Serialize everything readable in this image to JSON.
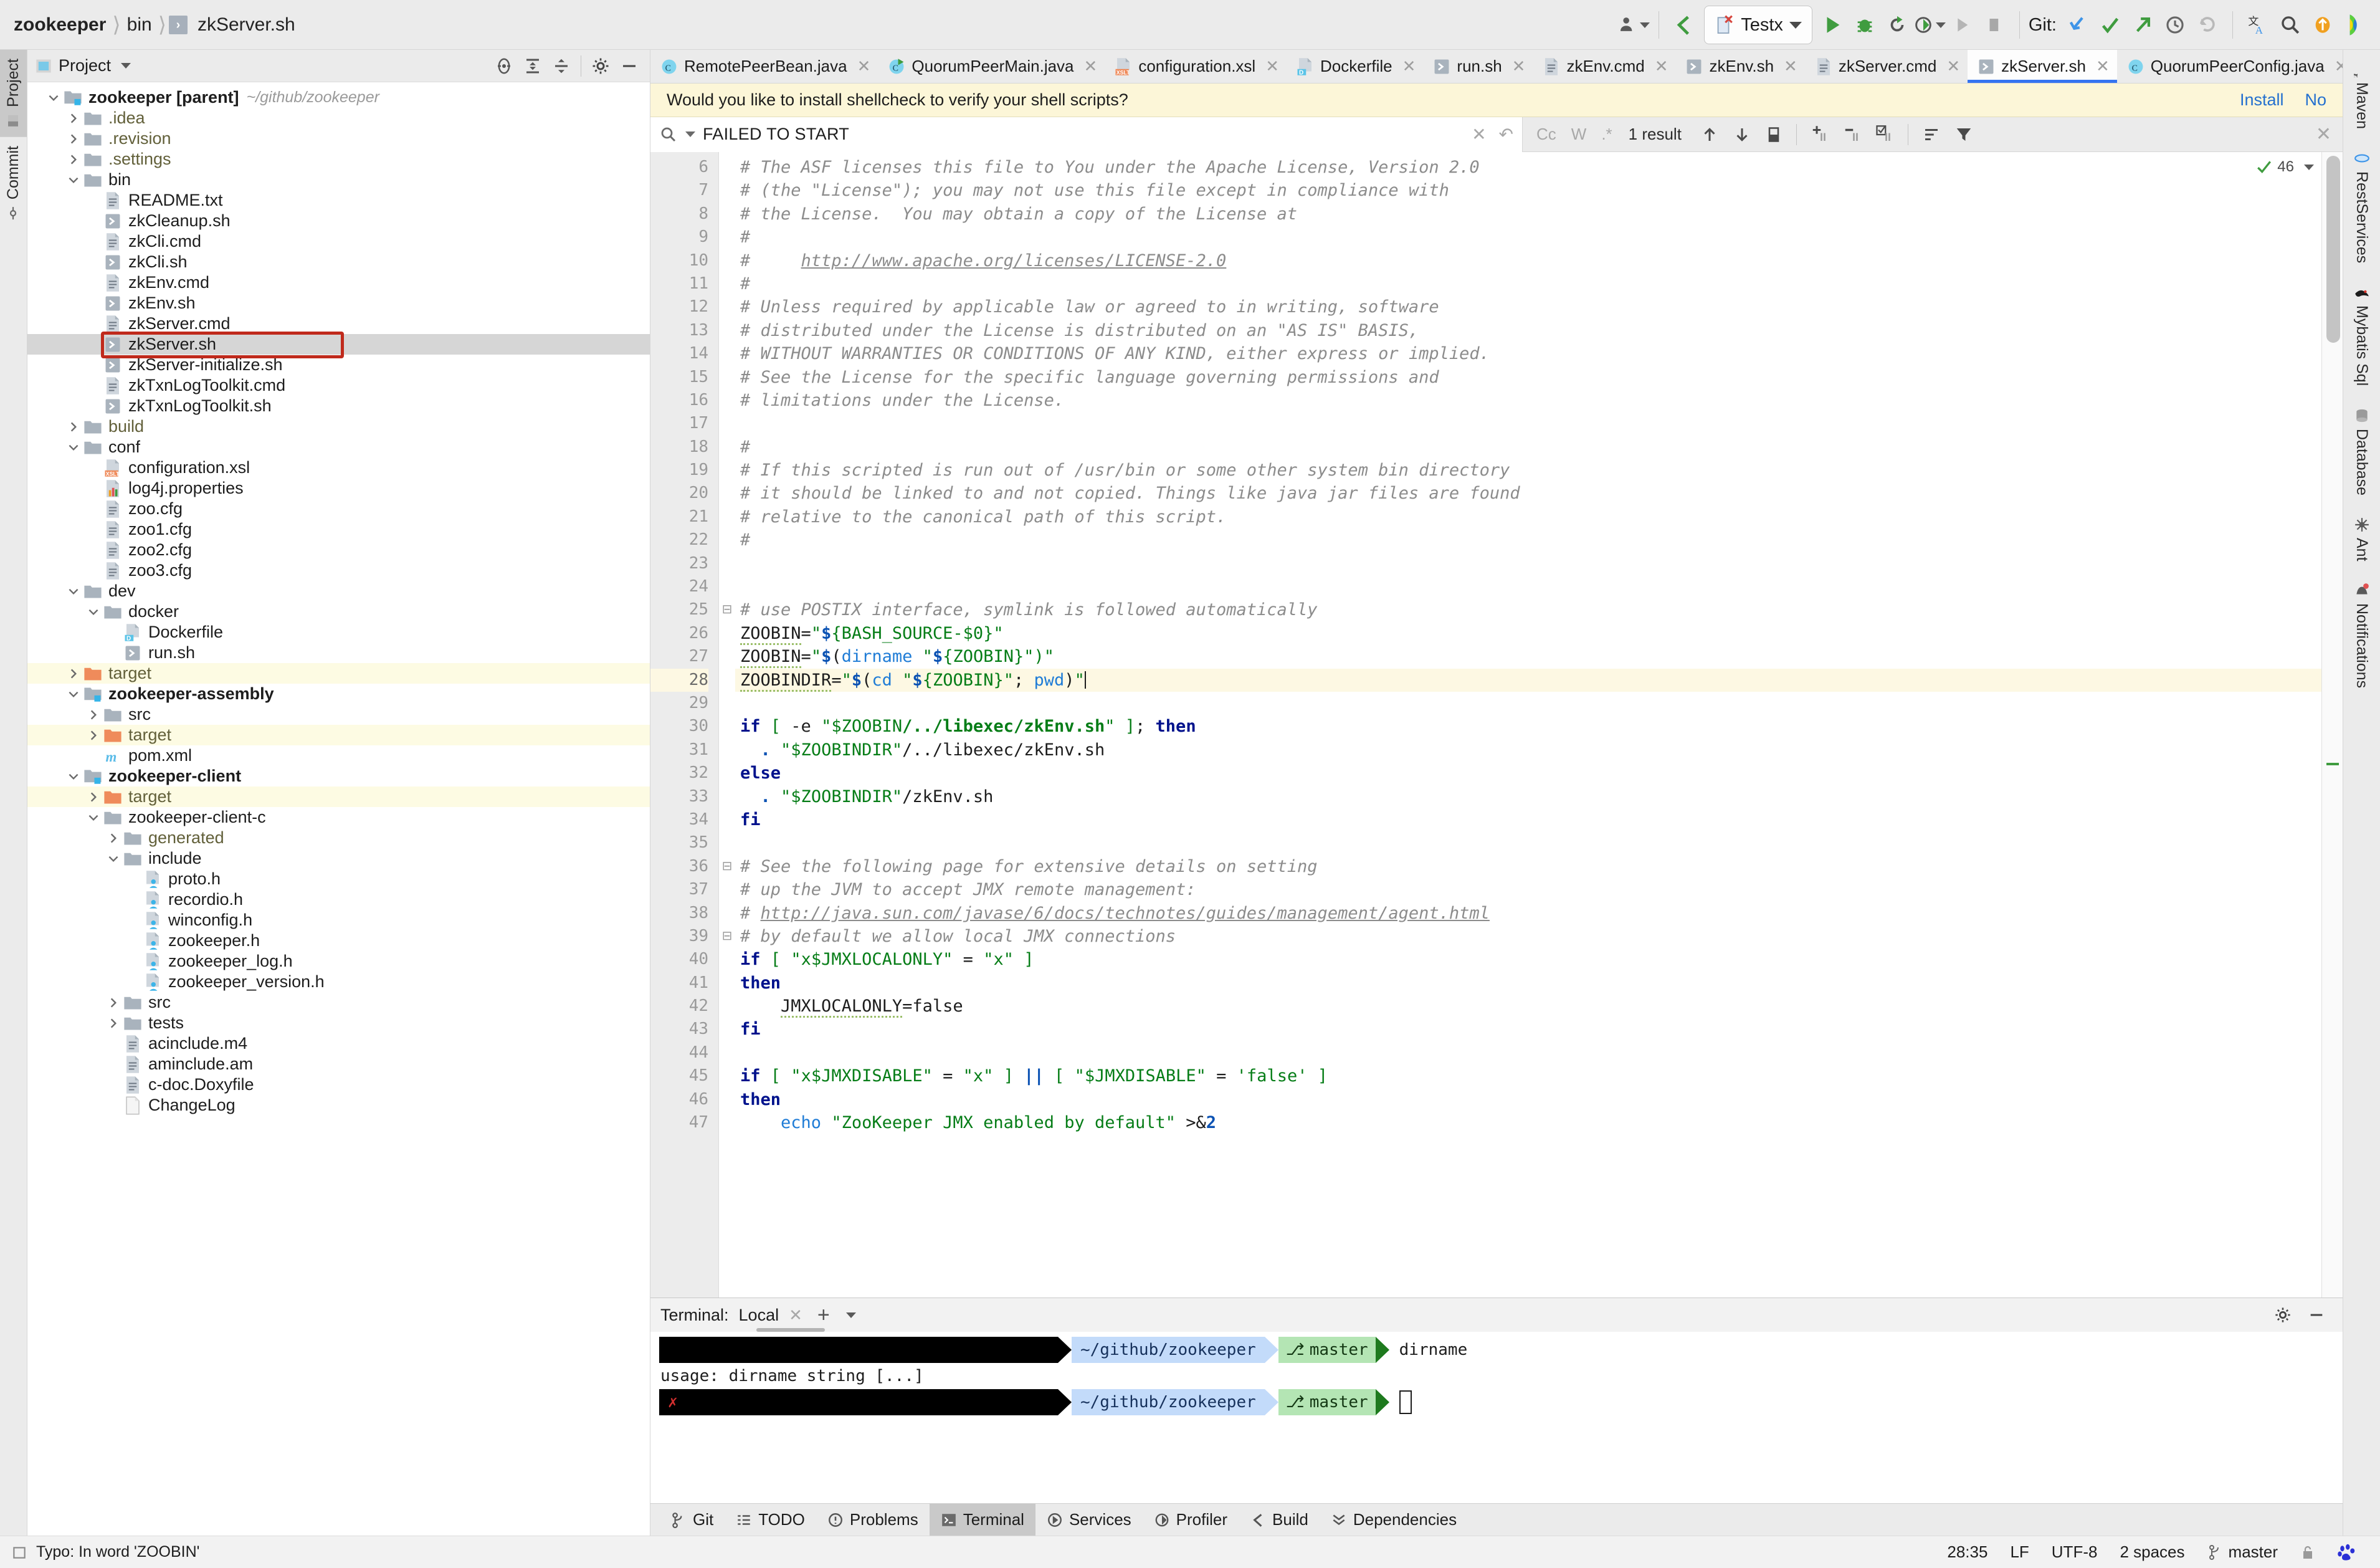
{
  "breadcrumb": {
    "items": [
      "zookeeper",
      "bin",
      "zkServer.sh"
    ],
    "sh_badge": "›"
  },
  "toolbar": {
    "run_config_label": "Testx",
    "git_label": "Git:",
    "icons": [
      "user-avatar-icon",
      "back-arrow-icon",
      "run-icon",
      "debug-icon",
      "rerun-icon",
      "coverage-icon",
      "profile-icon",
      "stop-icon",
      "git-update-icon",
      "git-commit-icon",
      "git-push-icon",
      "history-icon",
      "rollback-icon",
      "translate-icon",
      "search-everywhere-icon",
      "updates-icon",
      "ide-icon"
    ]
  },
  "left_strip": {
    "tabs": [
      {
        "label": "Project",
        "active": true
      },
      {
        "label": "Commit",
        "active": false
      }
    ]
  },
  "right_strip": {
    "tabs": [
      {
        "label": "Maven",
        "icon": "maven-icon"
      },
      {
        "label": "RestServices",
        "icon": "rest-services-icon"
      },
      {
        "label": "Mybatis Sql",
        "icon": "mybatis-icon"
      },
      {
        "label": "Database",
        "icon": "database-icon"
      },
      {
        "label": "Ant",
        "icon": "ant-icon"
      },
      {
        "label": "Notifications",
        "icon": "notifications-icon"
      }
    ]
  },
  "project": {
    "title": "Project",
    "tools": [
      "locate-icon",
      "expand-all-icon",
      "collapse-all-icon",
      "settings-gear-icon",
      "hide-icon"
    ],
    "tree": [
      {
        "depth": 0,
        "arrow": "down",
        "icon": "module-folder",
        "label": "zookeeper [parent]",
        "bold": true,
        "path": "~/github/zookeeper"
      },
      {
        "depth": 1,
        "arrow": "right",
        "icon": "folder",
        "label": ".idea",
        "olive": true
      },
      {
        "depth": 1,
        "arrow": "right",
        "icon": "folder",
        "label": ".revision",
        "olive": true
      },
      {
        "depth": 1,
        "arrow": "right",
        "icon": "folder",
        "label": ".settings",
        "olive": true
      },
      {
        "depth": 1,
        "arrow": "down",
        "icon": "folder",
        "label": "bin"
      },
      {
        "depth": 2,
        "arrow": "none",
        "icon": "text-file",
        "label": "README.txt"
      },
      {
        "depth": 2,
        "arrow": "none",
        "icon": "shell-file",
        "label": "zkCleanup.sh"
      },
      {
        "depth": 2,
        "arrow": "none",
        "icon": "text-file",
        "label": "zkCli.cmd"
      },
      {
        "depth": 2,
        "arrow": "none",
        "icon": "shell-file",
        "label": "zkCli.sh"
      },
      {
        "depth": 2,
        "arrow": "none",
        "icon": "text-file",
        "label": "zkEnv.cmd"
      },
      {
        "depth": 2,
        "arrow": "none",
        "icon": "shell-file",
        "label": "zkEnv.sh"
      },
      {
        "depth": 2,
        "arrow": "none",
        "icon": "text-file",
        "label": "zkServer.cmd"
      },
      {
        "depth": 2,
        "arrow": "none",
        "icon": "shell-file",
        "label": "zkServer.sh",
        "selected": true,
        "highlight": true
      },
      {
        "depth": 2,
        "arrow": "none",
        "icon": "shell-file",
        "label": "zkServer-initialize.sh"
      },
      {
        "depth": 2,
        "arrow": "none",
        "icon": "text-file",
        "label": "zkTxnLogToolkit.cmd"
      },
      {
        "depth": 2,
        "arrow": "none",
        "icon": "shell-file",
        "label": "zkTxnLogToolkit.sh"
      },
      {
        "depth": 1,
        "arrow": "right",
        "icon": "folder",
        "label": "build",
        "olive": true
      },
      {
        "depth": 1,
        "arrow": "down",
        "icon": "folder",
        "label": "conf"
      },
      {
        "depth": 2,
        "arrow": "none",
        "icon": "xslt-file",
        "label": "configuration.xsl"
      },
      {
        "depth": 2,
        "arrow": "none",
        "icon": "properties-file",
        "label": "log4j.properties"
      },
      {
        "depth": 2,
        "arrow": "none",
        "icon": "text-file",
        "label": "zoo.cfg"
      },
      {
        "depth": 2,
        "arrow": "none",
        "icon": "text-file",
        "label": "zoo1.cfg"
      },
      {
        "depth": 2,
        "arrow": "none",
        "icon": "text-file",
        "label": "zoo2.cfg"
      },
      {
        "depth": 2,
        "arrow": "none",
        "icon": "text-file",
        "label": "zoo3.cfg"
      },
      {
        "depth": 1,
        "arrow": "down",
        "icon": "folder",
        "label": "dev"
      },
      {
        "depth": 2,
        "arrow": "down",
        "icon": "folder",
        "label": "docker"
      },
      {
        "depth": 3,
        "arrow": "none",
        "icon": "docker-file",
        "label": "Dockerfile"
      },
      {
        "depth": 3,
        "arrow": "none",
        "icon": "shell-file",
        "label": "run.sh"
      },
      {
        "depth": 1,
        "arrow": "right",
        "icon": "target-folder",
        "label": "target",
        "olive": true,
        "target": true
      },
      {
        "depth": 1,
        "arrow": "down",
        "icon": "module-folder",
        "label": "zookeeper-assembly",
        "bold": true
      },
      {
        "depth": 2,
        "arrow": "right",
        "icon": "folder",
        "label": "src"
      },
      {
        "depth": 2,
        "arrow": "right",
        "icon": "target-folder",
        "label": "target",
        "olive": true,
        "target": true
      },
      {
        "depth": 2,
        "arrow": "none",
        "icon": "maven-file",
        "label": "pom.xml"
      },
      {
        "depth": 1,
        "arrow": "down",
        "icon": "module-folder",
        "label": "zookeeper-client",
        "bold": true
      },
      {
        "depth": 2,
        "arrow": "right",
        "icon": "target-folder",
        "label": "target",
        "olive": true,
        "target": true
      },
      {
        "depth": 2,
        "arrow": "down",
        "icon": "folder",
        "label": "zookeeper-client-c"
      },
      {
        "depth": 3,
        "arrow": "right",
        "icon": "folder",
        "label": "generated",
        "olive": true
      },
      {
        "depth": 3,
        "arrow": "down",
        "icon": "folder",
        "label": "include"
      },
      {
        "depth": 4,
        "arrow": "none",
        "icon": "header-file",
        "label": "proto.h"
      },
      {
        "depth": 4,
        "arrow": "none",
        "icon": "header-file",
        "label": "recordio.h"
      },
      {
        "depth": 4,
        "arrow": "none",
        "icon": "header-file",
        "label": "winconfig.h"
      },
      {
        "depth": 4,
        "arrow": "none",
        "icon": "header-file",
        "label": "zookeeper.h"
      },
      {
        "depth": 4,
        "arrow": "none",
        "icon": "header-file",
        "label": "zookeeper_log.h"
      },
      {
        "depth": 4,
        "arrow": "none",
        "icon": "header-file",
        "label": "zookeeper_version.h"
      },
      {
        "depth": 3,
        "arrow": "right",
        "icon": "folder",
        "label": "src"
      },
      {
        "depth": 3,
        "arrow": "right",
        "icon": "folder",
        "label": "tests"
      },
      {
        "depth": 3,
        "arrow": "none",
        "icon": "text-file",
        "label": "acinclude.m4"
      },
      {
        "depth": 3,
        "arrow": "none",
        "icon": "text-file",
        "label": "aminclude.am"
      },
      {
        "depth": 3,
        "arrow": "none",
        "icon": "text-file",
        "label": "c-doc.Doxyfile"
      },
      {
        "depth": 3,
        "arrow": "none",
        "icon": "plain-file",
        "label": "ChangeLog"
      }
    ]
  },
  "editor_tabs": [
    {
      "label": "RemotePeerBean.java",
      "icon": "java-class-icon",
      "active": false
    },
    {
      "label": "QuorumPeerMain.java",
      "icon": "java-run-icon",
      "active": false
    },
    {
      "label": "configuration.xsl",
      "icon": "xslt-file",
      "active": false
    },
    {
      "label": "Dockerfile",
      "icon": "docker-file",
      "active": false
    },
    {
      "label": "run.sh",
      "icon": "shell-file",
      "active": false
    },
    {
      "label": "zkEnv.cmd",
      "icon": "text-file",
      "active": false
    },
    {
      "label": "zkEnv.sh",
      "icon": "shell-file",
      "active": false
    },
    {
      "label": "zkServer.cmd",
      "icon": "text-file",
      "active": false
    },
    {
      "label": "zkServer.sh",
      "icon": "shell-file",
      "active": true
    },
    {
      "label": "QuorumPeerConfig.java",
      "icon": "java-class-icon",
      "active": false
    }
  ],
  "notification": {
    "message": "Would you like to install shellcheck to verify your shell scripts?",
    "install_label": "Install",
    "no_label": "No"
  },
  "find": {
    "query": "FAILED TO START",
    "result_count": "1 result",
    "opt_case": "Cc",
    "opt_word": "W",
    "opt_regex": ".*",
    "icons": [
      "search-dropdown-icon",
      "clear-icon",
      "history-icon",
      "prev-match-icon",
      "next-match-icon",
      "select-all-icon",
      "add-line-icon",
      "remove-line-icon",
      "check-line-icon",
      "sort-icon",
      "filter-icon",
      "close-find-icon"
    ]
  },
  "inspection": {
    "count": "46",
    "status_icon": "checkmark-green-icon"
  },
  "code": {
    "first_line": 6,
    "current_line": 28,
    "lines": [
      {
        "n": 6,
        "html": "<span class='cm'># The ASF licenses this file to You under the Apache License, Version 2.0</span>"
      },
      {
        "n": 7,
        "html": "<span class='cm'># (the \"License\"); you may not use this file except in compliance with</span>"
      },
      {
        "n": 8,
        "html": "<span class='cm'># the License.  You may obtain a copy of the License at</span>"
      },
      {
        "n": 9,
        "html": "<span class='cm'>#</span>"
      },
      {
        "n": 10,
        "html": "<span class='cm'>#     </span><span class='lnk'>http://www.apache.org/licenses/LICENSE-2.0</span>"
      },
      {
        "n": 11,
        "html": "<span class='cm'>#</span>"
      },
      {
        "n": 12,
        "html": "<span class='cm'># Unless required by applicable law or agreed to in writing, software</span>"
      },
      {
        "n": 13,
        "html": "<span class='cm'># distributed under the License is distributed on an \"AS IS\" BASIS,</span>"
      },
      {
        "n": 14,
        "html": "<span class='cm'># WITHOUT WARRANTIES OR CONDITIONS OF ANY KIND, either express or implied.</span>"
      },
      {
        "n": 15,
        "html": "<span class='cm'># See the License for the specific language governing permissions and</span>"
      },
      {
        "n": 16,
        "html": "<span class='cm'># limitations under the License.</span>"
      },
      {
        "n": 17,
        "html": ""
      },
      {
        "n": 18,
        "html": "<span class='cm'>#</span>"
      },
      {
        "n": 19,
        "html": "<span class='cm'># If this scripted is run out of /usr/bin or some other system bin directory</span>"
      },
      {
        "n": 20,
        "html": "<span class='cm'># it should be linked to and not copied. Things like java jar files are found</span>"
      },
      {
        "n": 21,
        "html": "<span class='cm'># relative to the canonical path of this script.</span>"
      },
      {
        "n": 22,
        "html": "<span class='cm'>#</span>"
      },
      {
        "n": 23,
        "html": ""
      },
      {
        "n": 24,
        "html": ""
      },
      {
        "n": 25,
        "html": "<span class='cm'># use POSTIX interface, symlink is followed automatically</span>",
        "fold": "minus"
      },
      {
        "n": 26,
        "html": "<span class='sq'>ZOOBIN</span>=<span class='str'>\"</span><span class='var'>$</span><span class='str'>{BASH_SOURCE-$0}\"</span>"
      },
      {
        "n": 27,
        "html": "<span class='sq'>ZOOBIN</span>=<span class='str'>\"</span><span class='var'>$</span>(<span class='fn'>dirname</span> <span class='str'>\"</span><span class='var'>$</span><span class='str'>{ZOOBIN}\")\"</span>"
      },
      {
        "n": 28,
        "html": "<span class='sq'>ZOOBINDIR</span>=<span class='str'>\"</span><span class='var'>$</span>(<span class='fn'>cd</span> <span class='str'>\"</span><span class='var'>$</span><span class='str'>{ZOOBIN}\"</span>; <span class='fn'>pwd</span>)<span class='str'>\"</span><span class='caret'></span>",
        "current": true
      },
      {
        "n": 29,
        "html": ""
      },
      {
        "n": 30,
        "html": "<span class='kw'>if</span> <span class='pl'>[</span> -e <span class='str'>\"$ZOOBIN</span><span class='str' style='font-weight:bold'>/../libexec/zkEnv.sh</span><span class='str'>\"</span> <span class='pl'>]</span>; <span class='kw'>then</span>"
      },
      {
        "n": 31,
        "html": "  <span class='var'>.</span> <span class='str'>\"$ZOOBINDIR\"</span>/../libexec/zkEnv.sh"
      },
      {
        "n": 32,
        "html": "<span class='kw'>else</span>"
      },
      {
        "n": 33,
        "html": "  <span class='var'>.</span> <span class='str'>\"$ZOOBINDIR\"</span>/zkEnv.sh"
      },
      {
        "n": 34,
        "html": "<span class='kw'>fi</span>"
      },
      {
        "n": 35,
        "html": ""
      },
      {
        "n": 36,
        "html": "<span class='cm'># See the following page for extensive details on setting</span>",
        "fold": "minus"
      },
      {
        "n": 37,
        "html": "<span class='cm'># up the JVM to accept JMX remote management:</span>"
      },
      {
        "n": 38,
        "html": "<span class='cm'># </span><span class='lnk'>http://java.sun.com/javase/6/docs/technotes/guides/management/agent.html</span>"
      },
      {
        "n": 39,
        "html": "<span class='cm'># by default we allow local JMX connections</span>",
        "fold": "minus"
      },
      {
        "n": 40,
        "html": "<span class='kw'>if</span> <span class='pl'>[</span> <span class='str'>\"x$JMXLOCALONLY\"</span> = <span class='str'>\"x\"</span> <span class='pl'>]</span>"
      },
      {
        "n": 41,
        "html": "<span class='kw'>then</span>"
      },
      {
        "n": 42,
        "html": "    <span class='sq'>JMXLOCALONLY</span>=false"
      },
      {
        "n": 43,
        "html": "<span class='kw'>fi</span>"
      },
      {
        "n": 44,
        "html": ""
      },
      {
        "n": 45,
        "html": "<span class='kw'>if</span> <span class='pl'>[</span> <span class='str'>\"x$JMXDISABLE\"</span> = <span class='str'>\"x\"</span> <span class='pl'>]</span> <span class='var'>||</span> <span class='pl'>[</span> <span class='str'>\"$JMXDISABLE\"</span> = <span class='str'>'false'</span> <span class='pl'>]</span>"
      },
      {
        "n": 46,
        "html": "<span class='kw'>then</span>"
      },
      {
        "n": 47,
        "html": "    <span class='fn'>echo</span> <span class='str'>\"ZooKeeper JMX enabled by default\"</span> &gt;&amp;<span class='var'>2</span>"
      }
    ]
  },
  "terminal": {
    "title": "Terminal:",
    "tab_label": "Local",
    "lines": [
      {
        "type": "prompt",
        "path": "~/github/zookeeper",
        "branch": "master",
        "command": "dirname",
        "error": false
      },
      {
        "type": "output",
        "text": "usage: dirname string [...]"
      },
      {
        "type": "prompt",
        "path": "~/github/zookeeper",
        "branch": "master",
        "command": "",
        "error": true
      }
    ]
  },
  "bottom_tabs": [
    {
      "label": "Git",
      "icon": "git-branch-icon",
      "active": false
    },
    {
      "label": "TODO",
      "icon": "todo-icon",
      "active": false
    },
    {
      "label": "Problems",
      "icon": "problems-icon",
      "active": false
    },
    {
      "label": "Terminal",
      "icon": "terminal-icon",
      "active": true
    },
    {
      "label": "Services",
      "icon": "services-icon",
      "active": false
    },
    {
      "label": "Profiler",
      "icon": "profiler-icon",
      "active": false
    },
    {
      "label": "Build",
      "icon": "build-icon",
      "active": false
    },
    {
      "label": "Dependencies",
      "icon": "dependencies-icon",
      "active": false
    }
  ],
  "status": {
    "message": "Typo: In word 'ZOOBIN'",
    "caret_position": "28:35",
    "line_separator": "LF",
    "encoding": "UTF-8",
    "indent": "2 spaces",
    "branch": "master"
  },
  "colors": {
    "accent": "#3574f0",
    "notification_bg": "#fcf6d8",
    "highlight_box": "#c02a1c",
    "target_folder": "#ef8b5b",
    "keyword": "#00128c",
    "string": "#067d17",
    "comment": "#8c8c8c"
  }
}
